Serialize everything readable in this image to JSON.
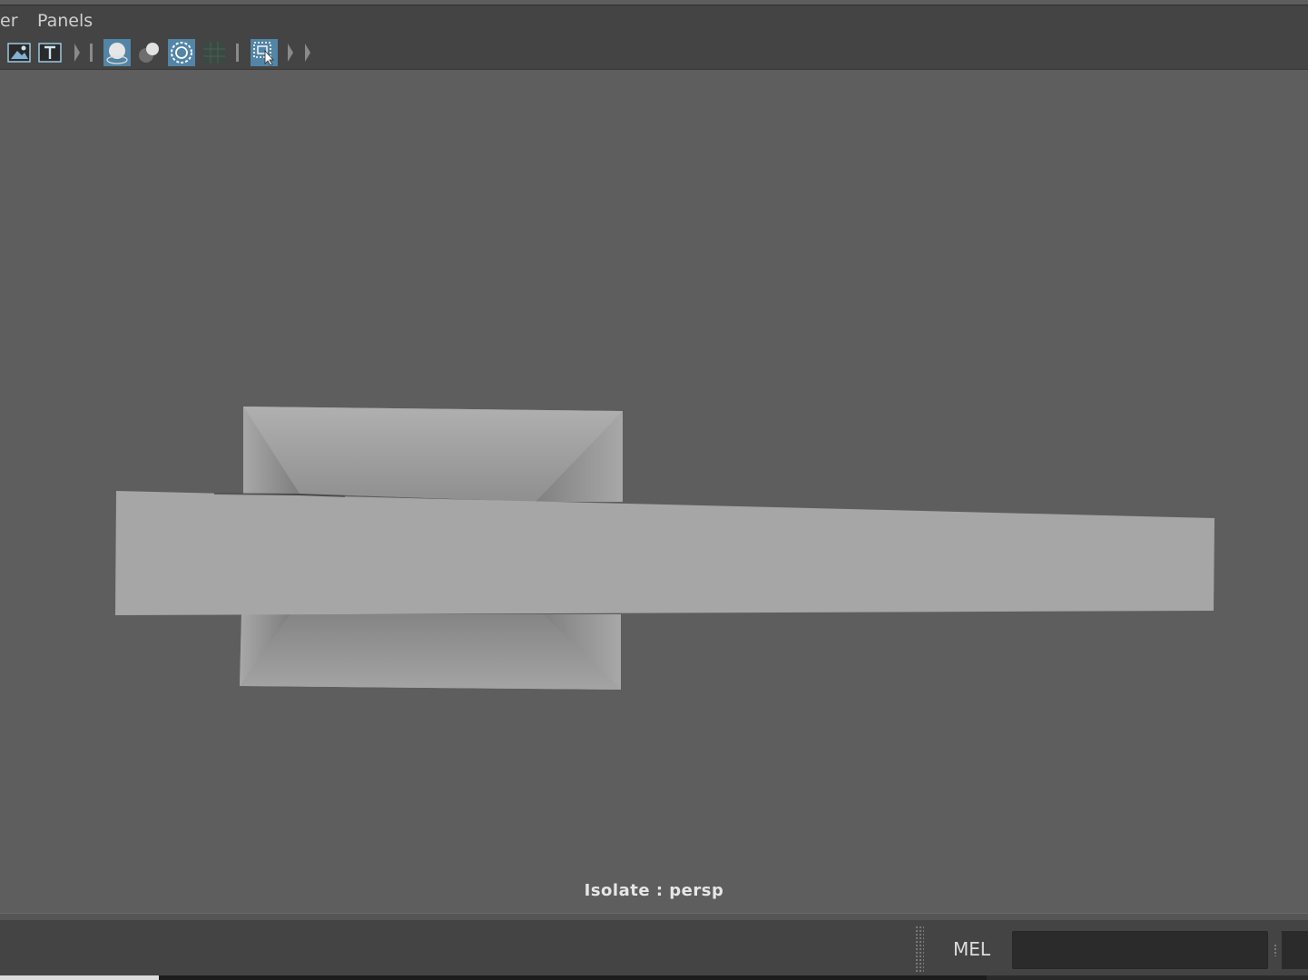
{
  "menubar": {
    "items": [
      {
        "label": "er"
      },
      {
        "label": "Panels"
      }
    ]
  },
  "toolbar": {
    "buttons": [
      {
        "icon": "image-plane-icon",
        "active": false
      },
      {
        "icon": "text-t-icon",
        "active": false
      },
      {
        "icon": "wireframe-on-shaded-icon",
        "active": true
      },
      {
        "icon": "xray-icon",
        "active": false
      },
      {
        "icon": "isolate-select-icon",
        "active": true
      },
      {
        "icon": "grid-dark-icon",
        "active": false
      },
      {
        "icon": "select-camera-icon",
        "active": true
      }
    ]
  },
  "viewport": {
    "hud_label": "Isolate : persp",
    "background_color": "#5e5e5e",
    "mesh_color": "#a6a6a6"
  },
  "command_line": {
    "language_label": "MEL",
    "input_value": ""
  }
}
